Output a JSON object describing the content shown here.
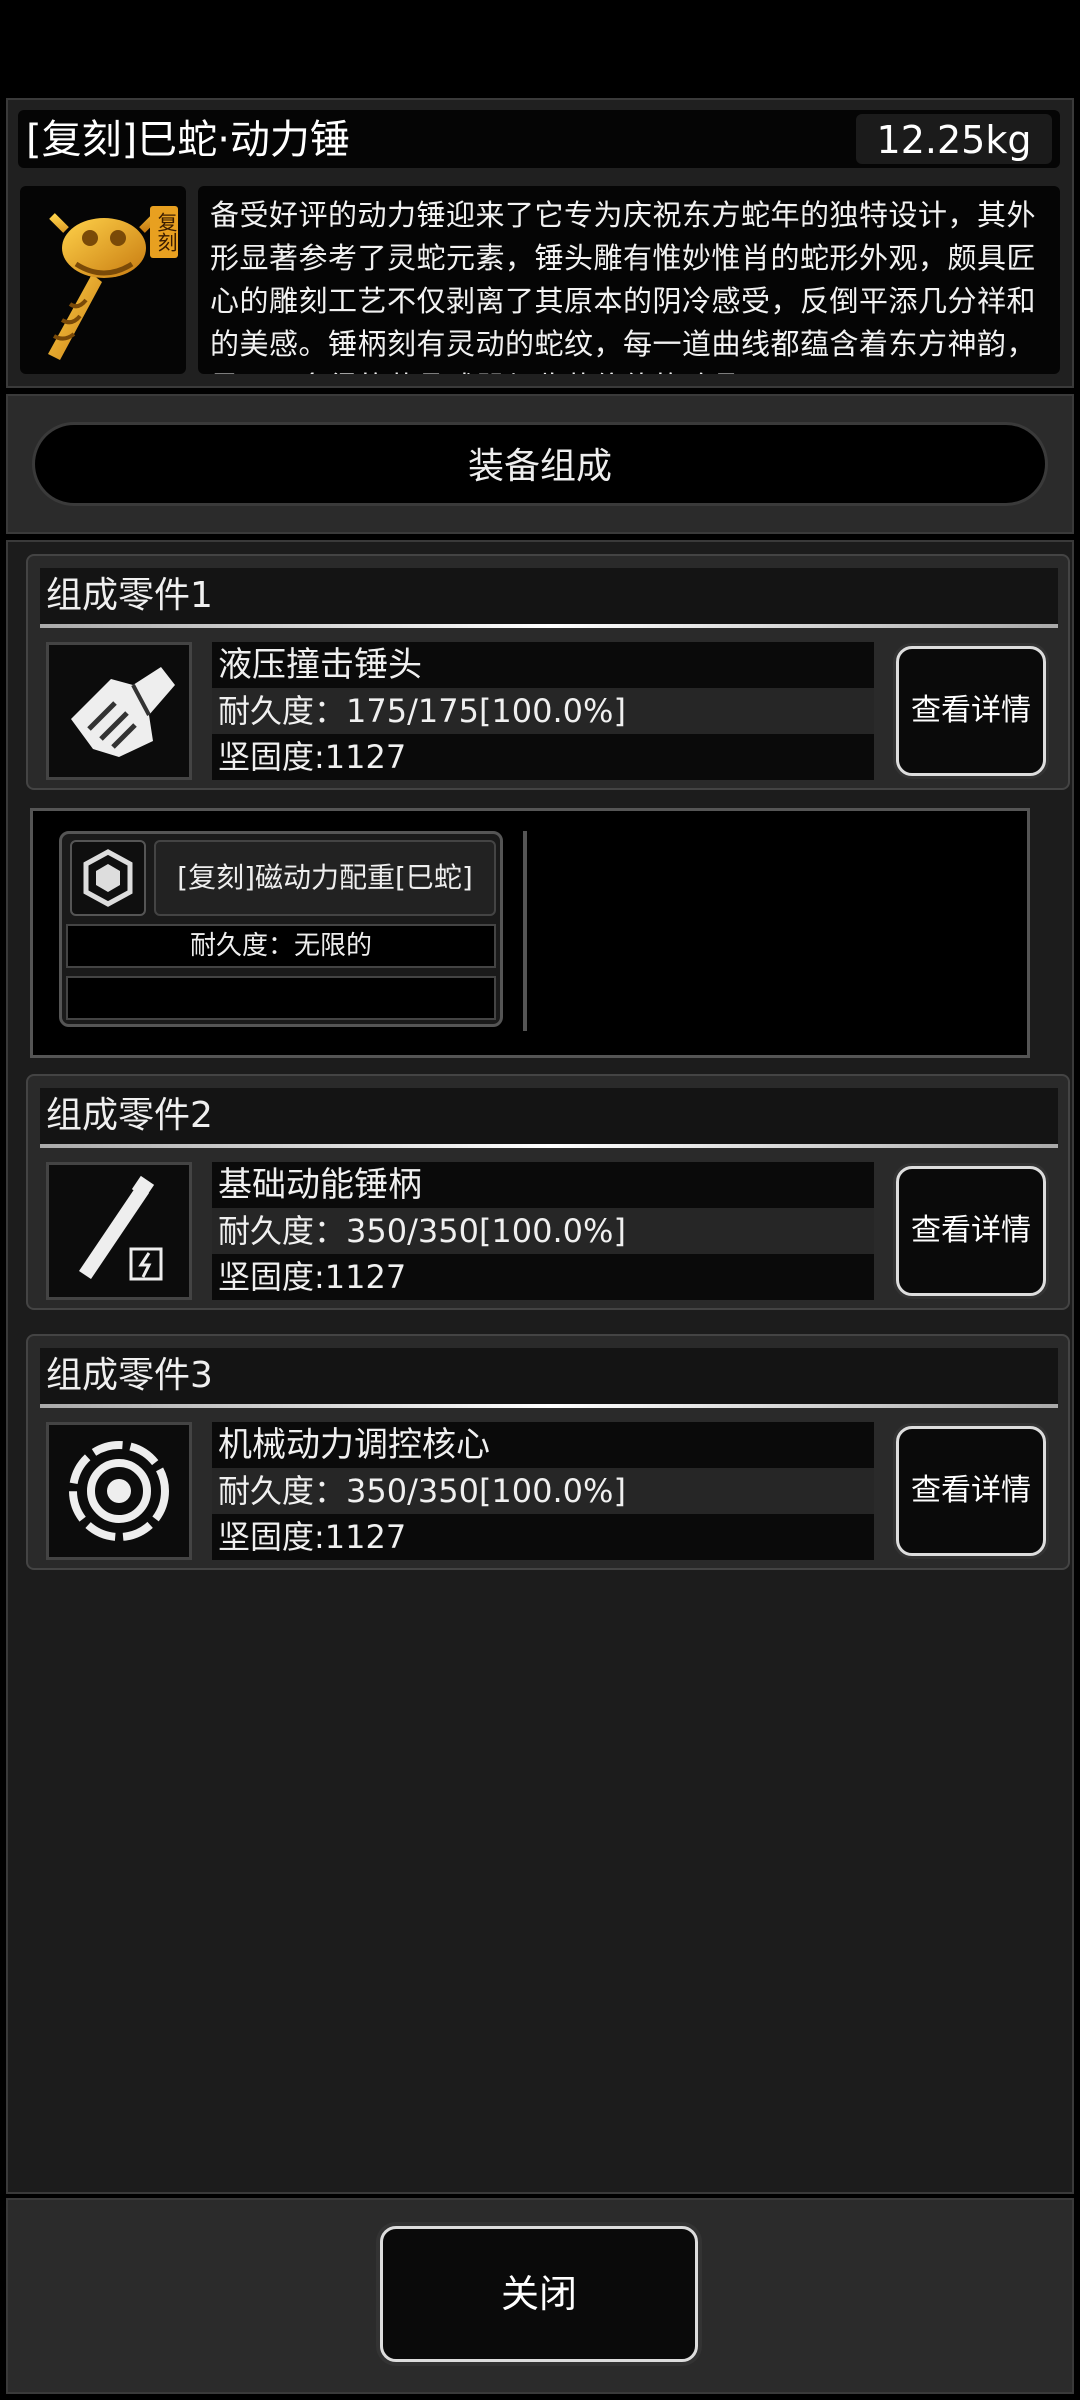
{
  "header": {
    "title": "[复刻]巳蛇·动力锤",
    "weight": "12.25kg",
    "description": "备受好评的动力锤迎来了它专为庆祝东方蛇年的独特设计，其外形显著参考了灵蛇元素，锤头雕有惟妙惟肖的蛇形外观，颇具匠心的雕刻工艺不仅剥离了其原本的阴冷感受，反倒平添几分祥和的美感。锤柄刻有灵动的蛇纹，每一道曲线都蕴含着东方神韵，是不可多得的藏品武器与收藏价值的珍品",
    "badge_text": "复刻",
    "accent_color": "#e8a020"
  },
  "section": {
    "label": "装备组成"
  },
  "parts": [
    {
      "header": "组成零件1",
      "name": "液压撞击锤头",
      "durability": "耐久度：175/175[100.0%]",
      "hardness": "坚固度:1127",
      "button": "查看详情",
      "icon": "hammer-head-icon"
    },
    {
      "header": "组成零件2",
      "name": "基础动能锤柄",
      "durability": "耐久度：350/350[100.0%]",
      "hardness": "坚固度:1127",
      "button": "查看详情",
      "icon": "hammer-handle-icon"
    },
    {
      "header": "组成零件3",
      "name": "机械动力调控核心",
      "durability": "耐久度：350/350[100.0%]",
      "hardness": "坚固度:1127",
      "button": "查看详情",
      "icon": "power-core-icon"
    }
  ],
  "attachment": {
    "name": "[复刻]磁动力配重[巳蛇]",
    "durability": "耐久度：无限的",
    "icon": "counterweight-icon"
  },
  "footer": {
    "close_label": "关闭"
  }
}
